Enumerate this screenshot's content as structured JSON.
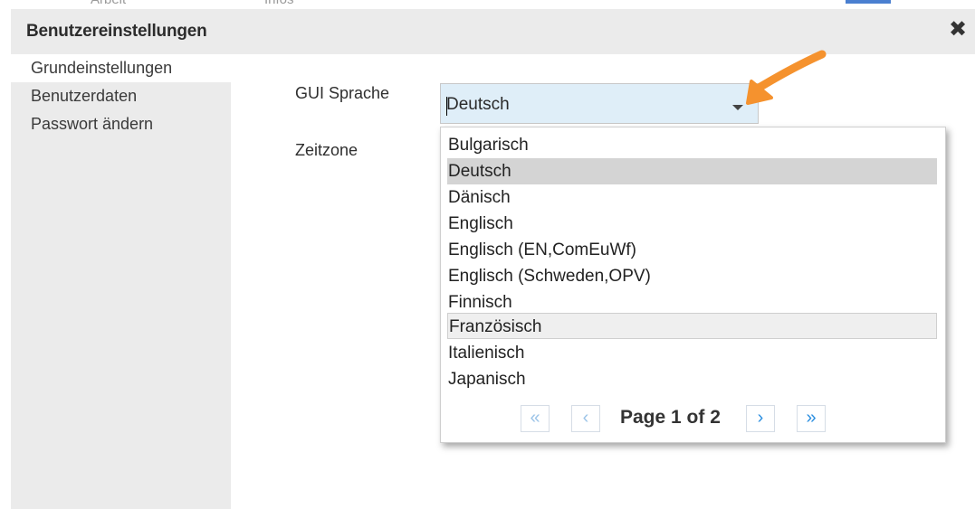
{
  "background_partial": {
    "left_text": "Arbeit",
    "right_text": "Infos"
  },
  "dialog": {
    "title": "Benutzereinstellungen",
    "close_icon": "close-icon",
    "sidebar": {
      "items": [
        {
          "label": "Grundeinstellungen",
          "active": true
        },
        {
          "label": "Benutzerdaten",
          "active": false
        },
        {
          "label": "Passwort ändern",
          "active": false
        }
      ]
    },
    "form": {
      "gui_language": {
        "label": "GUI Sprache",
        "value": "Deutsch",
        "dropdown_icon": "chevron-down-icon",
        "open": true
      },
      "timezone": {
        "label": "Zeitzone"
      }
    },
    "dropdown": {
      "options": [
        "Bulgarisch",
        "Deutsch",
        "Dänisch",
        "Englisch",
        "Englisch (EN,ComEuWf)",
        "Englisch (Schweden,OPV)",
        "Finnisch",
        "Französisch",
        "Italienisch",
        "Japanisch"
      ],
      "selected": "Deutsch",
      "hovered": "Französisch",
      "pager": {
        "first_icon": "«",
        "prev_icon": "‹",
        "next_icon": "›",
        "last_icon": "»",
        "page_text": "Page 1 of 2",
        "current_page": 1,
        "total_pages": 2
      }
    }
  },
  "annotation": {
    "type": "arrow",
    "color": "#f5922e"
  },
  "colors": {
    "accent_blue": "#2c8fe0",
    "combo_bg": "#dfeef8",
    "selected_bg": "#d4d4d4",
    "panel_bg": "#ebebeb"
  }
}
